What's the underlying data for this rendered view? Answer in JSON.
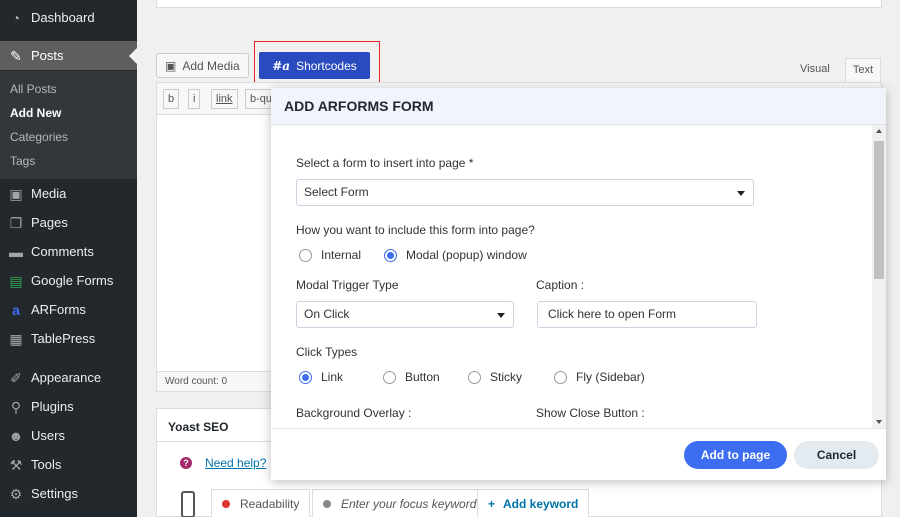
{
  "sidebar": {
    "items": [
      {
        "label": "Dashboard",
        "icon": "dashboard-icon"
      },
      {
        "label": "Posts",
        "icon": "pin-icon"
      },
      {
        "label": "Media",
        "icon": "media-icon"
      },
      {
        "label": "Pages",
        "icon": "pages-icon"
      },
      {
        "label": "Comments",
        "icon": "comment-icon"
      },
      {
        "label": "Google Forms",
        "icon": "google-forms-icon"
      },
      {
        "label": "ARForms",
        "icon": "arforms-icon"
      },
      {
        "label": "TablePress",
        "icon": "table-icon"
      },
      {
        "label": "Appearance",
        "icon": "brush-icon"
      },
      {
        "label": "Plugins",
        "icon": "plugin-icon"
      },
      {
        "label": "Users",
        "icon": "users-icon"
      },
      {
        "label": "Tools",
        "icon": "wrench-icon"
      },
      {
        "label": "Settings",
        "icon": "settings-icon"
      }
    ],
    "submenu": [
      "All Posts",
      "Add New",
      "Categories",
      "Tags"
    ]
  },
  "editor": {
    "add_media": "Add Media",
    "shortcodes": "Shortcodes",
    "tab_visual": "Visual",
    "tab_text": "Text",
    "quicktags": [
      "b",
      "i",
      "link",
      "b-qu"
    ],
    "word_count": "Word count: 0"
  },
  "yoast": {
    "title": "Yoast SEO",
    "need_help": "Need help?",
    "readability": "Readability",
    "focus_keyword": "Enter your focus keyword",
    "add_keyword": "Add keyword"
  },
  "modal": {
    "title": "ADD ARFORMS FORM",
    "select_label": "Select a form to insert into page *",
    "select_value": "Select Form",
    "include_label": "How you want to include this form into page?",
    "include_options": [
      "Internal",
      "Modal (popup) window"
    ],
    "include_selected": 1,
    "trigger_label": "Modal Trigger Type",
    "trigger_value": "On Click",
    "caption_label": "Caption :",
    "caption_value": "Click here to open Form",
    "click_types_label": "Click Types",
    "click_types": [
      "Link",
      "Button",
      "Sticky",
      "Fly (Sidebar)"
    ],
    "click_type_selected": 0,
    "overlay_label": "Background Overlay :",
    "close_button_label": "Show Close Button :",
    "add_button": "Add to page",
    "cancel_button": "Cancel"
  }
}
